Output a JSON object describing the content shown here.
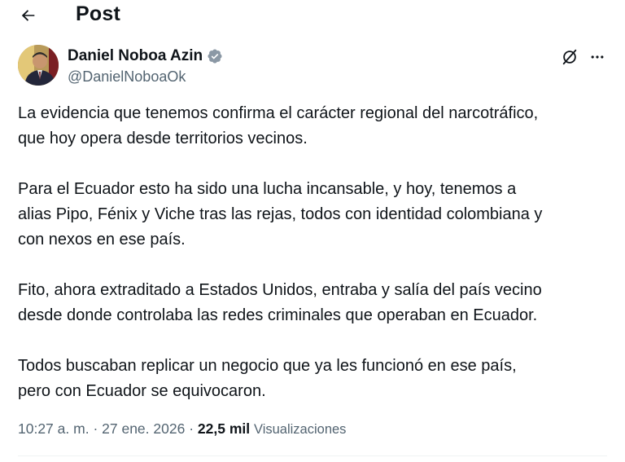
{
  "header": {
    "title": "Post",
    "back_icon": "arrow-left-icon"
  },
  "author": {
    "name": "Daniel Noboa Azin",
    "handle": "@DanielNoboaOk",
    "verified": true,
    "verified_color": "#1d9bf0"
  },
  "actions": {
    "grok_icon": "grok-icon",
    "more_icon": "more-horizontal-icon"
  },
  "tweet": {
    "paragraphs": [
      {
        "lines": [
          "La evidencia que tenemos confirma el carácter regional del narcotráfico,",
          "que hoy opera desde territorios vecinos."
        ]
      },
      {
        "lines": [
          "Para el Ecuador esto ha sido una lucha incansable, y hoy, tenemos a",
          "alias Pipo, Fénix y Viche tras las rejas, todos con identidad colombiana y",
          "con nexos en ese país."
        ]
      },
      {
        "lines": [
          "Fito, ahora extraditado a Estados Unidos, entraba y salía del país vecino",
          "desde donde controlaba las redes criminales que operaban en Ecuador."
        ]
      },
      {
        "lines": [
          "Todos buscaban replicar un negocio que ya les funcionó en ese país,",
          "pero con Ecuador se equivocaron."
        ]
      }
    ]
  },
  "meta": {
    "time": "10:27 a. m.",
    "separator": "·",
    "date": "27 ene. 2026",
    "views_count": "22,5 mil",
    "views_label": "Visualizaciones"
  },
  "colors": {
    "text": "#0f1419",
    "secondary": "#536471",
    "divider": "#eff3f4"
  }
}
